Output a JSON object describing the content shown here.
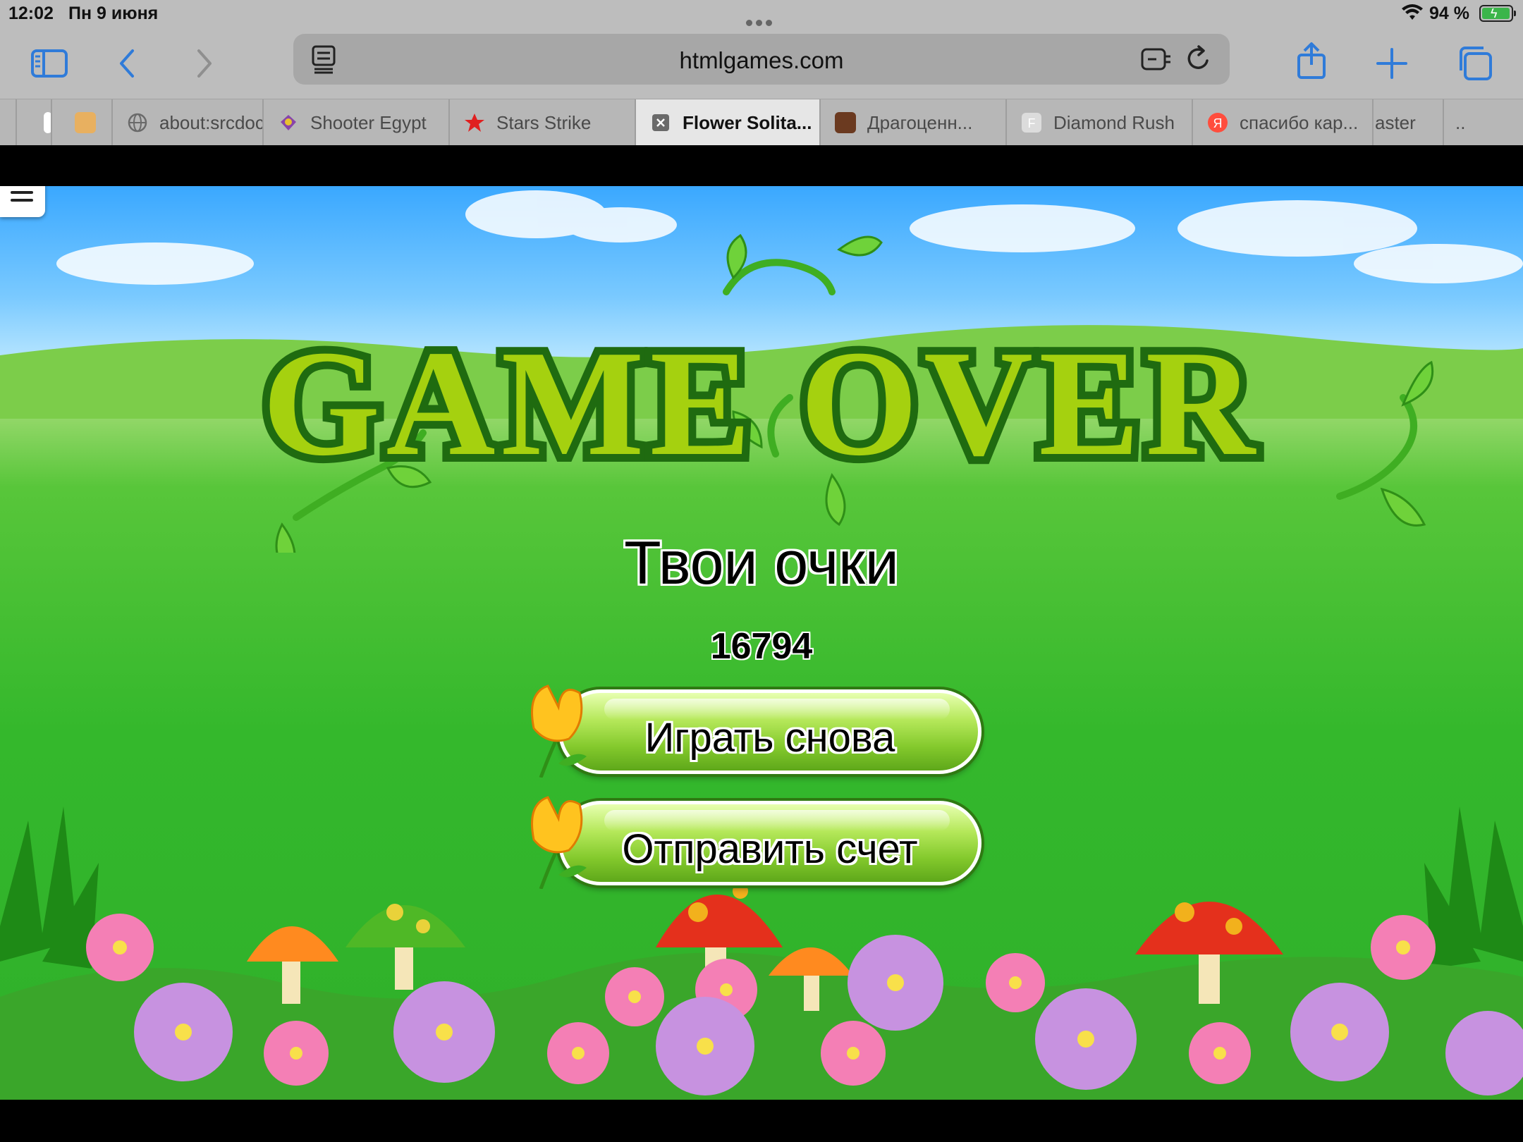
{
  "status": {
    "time": "12:02",
    "date": "Пн 9 июня",
    "battery": "94 %"
  },
  "toolbar": {
    "url": "htmlgames.com"
  },
  "tabs": [
    {
      "label": "",
      "favicon_color": "#ffffff"
    },
    {
      "label": "",
      "favicon_color": "#e8b060"
    },
    {
      "label": "about:srcdoc",
      "favicon_color": "#8a8a8a"
    },
    {
      "label": "Shooter Egypt",
      "favicon_color": "#8844aa"
    },
    {
      "label": "Stars Strike",
      "favicon_color": "#e02020"
    },
    {
      "label": "Flower Solita...",
      "favicon_color": "#6a6a6a"
    },
    {
      "label": "Драгоценн...",
      "favicon_color": "#6b3a20"
    },
    {
      "label": "Diamond Rush",
      "favicon_color": "#d9d9d9"
    },
    {
      "label": "спасибо кар...",
      "favicon_color": "#ff4d3d"
    },
    {
      "label": "aster",
      "favicon_color": ""
    },
    {
      "label": "..",
      "favicon_color": ""
    }
  ],
  "game": {
    "title": "GAME OVER",
    "score_label": "Твои очки",
    "score_value": "16794",
    "play_again": "Играть снова",
    "submit_score": "Отправить счет"
  },
  "colors": {
    "accent": "#1a73e8",
    "title_green": "#a5d10f",
    "title_outline": "#1f6b10"
  }
}
